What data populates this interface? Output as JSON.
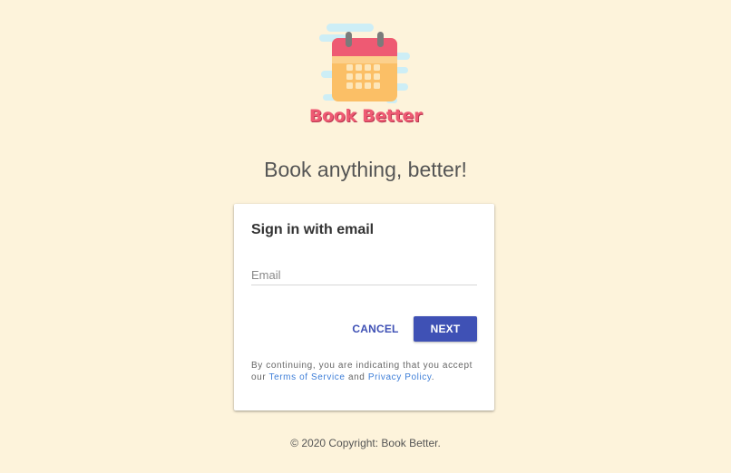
{
  "brand": {
    "name": "Book Better",
    "logo_icon": "calendar-icon",
    "colors": {
      "brand_pink": "#ee5a73",
      "calendar_body": "#fbbf66",
      "page_background": "#fdf3db"
    }
  },
  "headline": "Book anything, better!",
  "signin": {
    "title": "Sign in with email",
    "email_placeholder": "Email",
    "email_value": "",
    "cancel_label": "CANCEL",
    "next_label": "NEXT",
    "primary_color": "#3f51b5",
    "legal": {
      "prefix": "By continuing, you are indicating that you accept our",
      "terms_link": "Terms of Service",
      "middle": "and",
      "privacy_link": "Privacy Policy",
      "suffix": "."
    }
  },
  "footer": {
    "copyright": "© 2020 Copyright: Book Better."
  }
}
